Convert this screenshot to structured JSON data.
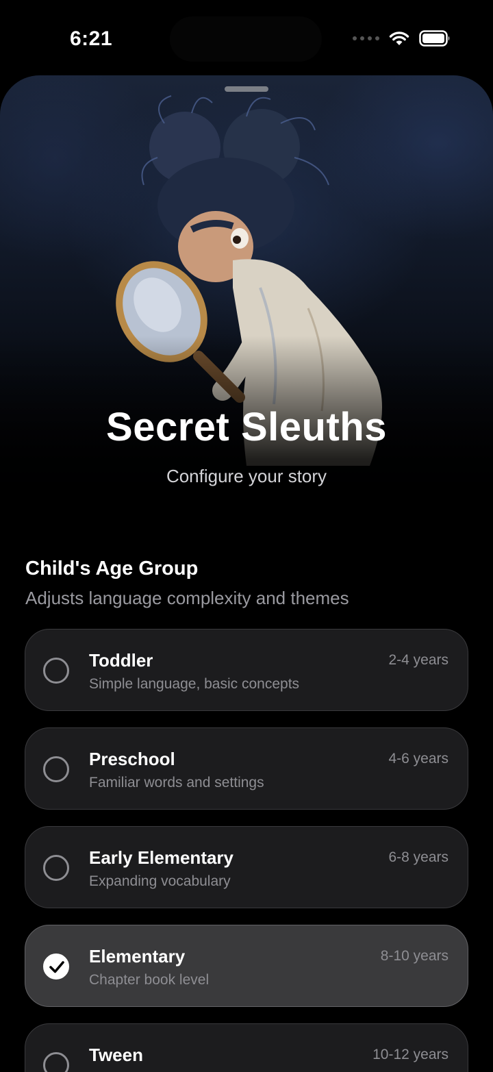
{
  "status": {
    "time": "6:21"
  },
  "hero": {
    "title": "Secret Sleuths",
    "subtitle": "Configure your story"
  },
  "section": {
    "title": "Child's Age Group",
    "description": "Adjusts language complexity and themes"
  },
  "age_groups": [
    {
      "label": "Toddler",
      "description": "Simple language, basic concepts",
      "range": "2-4 years",
      "selected": false
    },
    {
      "label": "Preschool",
      "description": "Familiar words and settings",
      "range": "4-6 years",
      "selected": false
    },
    {
      "label": "Early Elementary",
      "description": "Expanding vocabulary",
      "range": "6-8 years",
      "selected": false
    },
    {
      "label": "Elementary",
      "description": "Chapter book level",
      "range": "8-10 years",
      "selected": true
    },
    {
      "label": "Tween",
      "description": "",
      "range": "10-12 years",
      "selected": false
    }
  ],
  "icons": {
    "wifi": "wifi-icon",
    "battery": "battery-icon",
    "radio_unchecked": "radio-unchecked-icon",
    "radio_checked": "checkmark-icon"
  },
  "colors": {
    "background": "#000000",
    "card": "#1c1c1e",
    "card_selected": "#3a3a3c",
    "secondary_text": "#8e8e93"
  }
}
